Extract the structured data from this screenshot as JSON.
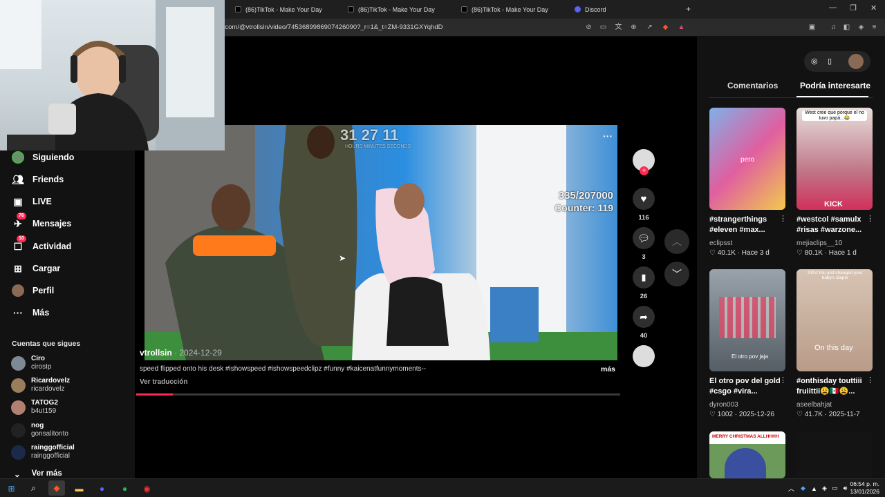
{
  "browser": {
    "tabs": [
      {
        "label": "(86)TikTok - Make Your Day"
      },
      {
        "label": "(86)TikTok - Make Your Day"
      },
      {
        "label": "(86)TikTok - Make Your Day"
      },
      {
        "label": "Discord"
      }
    ],
    "url": "k.com/@vtrollsin/video/7453689986907426090?_r=1&_t=ZM-9331GXYqhdD"
  },
  "sidebar": {
    "items": [
      {
        "label": "Siguiendo",
        "icon": "following-avatar-icon"
      },
      {
        "label": "Friends",
        "icon": "friends-icon"
      },
      {
        "label": "LIVE",
        "icon": "live-icon"
      },
      {
        "label": "Mensajes",
        "icon": "messages-icon",
        "badge": "76"
      },
      {
        "label": "Actividad",
        "icon": "activity-icon",
        "badge": "10"
      },
      {
        "label": "Cargar",
        "icon": "upload-icon"
      },
      {
        "label": "Perfil",
        "icon": "profile-icon"
      },
      {
        "label": "Más",
        "icon": "more-icon"
      }
    ],
    "following_title": "Cuentas que sigues",
    "following": [
      {
        "name": "Ciro",
        "user": "cirosIp"
      },
      {
        "name": "Ricardovelz",
        "user": "ricardovelz"
      },
      {
        "name": "TATOG2",
        "user": "b4ut159"
      },
      {
        "name": "nog",
        "user": "gonsalitonto"
      },
      {
        "name": "rainggofficial",
        "user": "rainggofficial"
      }
    ],
    "see_more": "Ver más"
  },
  "video": {
    "overlay_timer": "31 27 11",
    "overlay_timer_labels": "HOURS MINUTES SECONDS",
    "overlay_counter_1": "335/207000",
    "overlay_counter_2": "Counter: 119",
    "progress": 0.075,
    "author": "vtrollsin",
    "date": "· 2024-12-29",
    "caption": "speed flipped onto his desk #ishowspeed #ishowspeedclipz #funny #kaicenatfunnymoments--",
    "more": "más",
    "translate": "Ver traducción"
  },
  "actions": {
    "likes": "116",
    "comments": "3",
    "saves": "26",
    "shares": "40"
  },
  "right_panel": {
    "tabs": [
      "Comentarios",
      "Podría interesarte"
    ],
    "active_tab": 1,
    "cards": [
      {
        "title": "#strangerthings #eleven #max...",
        "user": "eclipsst",
        "stats": "♡ 40.1K · Hace 3 d",
        "overlay": "pero"
      },
      {
        "title": "#westcol #samulx #risas #warzone...",
        "user": "mejiaclips__10",
        "stats": "♡ 80.1K · Hace 1 d",
        "overlay": "West cree que porque el no tuvo papá...😂",
        "overlay2": "KICK"
      },
      {
        "title": "El otro pov del gold #csgo #vira...",
        "user": "dyron003",
        "stats": "♡ 1002 · 2025-12-26",
        "overlay": "El otro pov jaja"
      },
      {
        "title": "#onthisday touttiii fruiittii😩🇲🇽😩...",
        "user": "aseelbahjat",
        "stats": "♡ 41.7K · 2025-11-7",
        "overlay": "POV:You just changed your baby's diaper",
        "overlay2": "On this day"
      },
      {
        "overlay": "MERRY CHRISTMAS ALLHHHH"
      }
    ]
  },
  "taskbar": {
    "time": "06:54 p. m.",
    "date": "13/01/2026"
  },
  "colors": {
    "accent": "#fe2c55",
    "bg": "#121212"
  }
}
